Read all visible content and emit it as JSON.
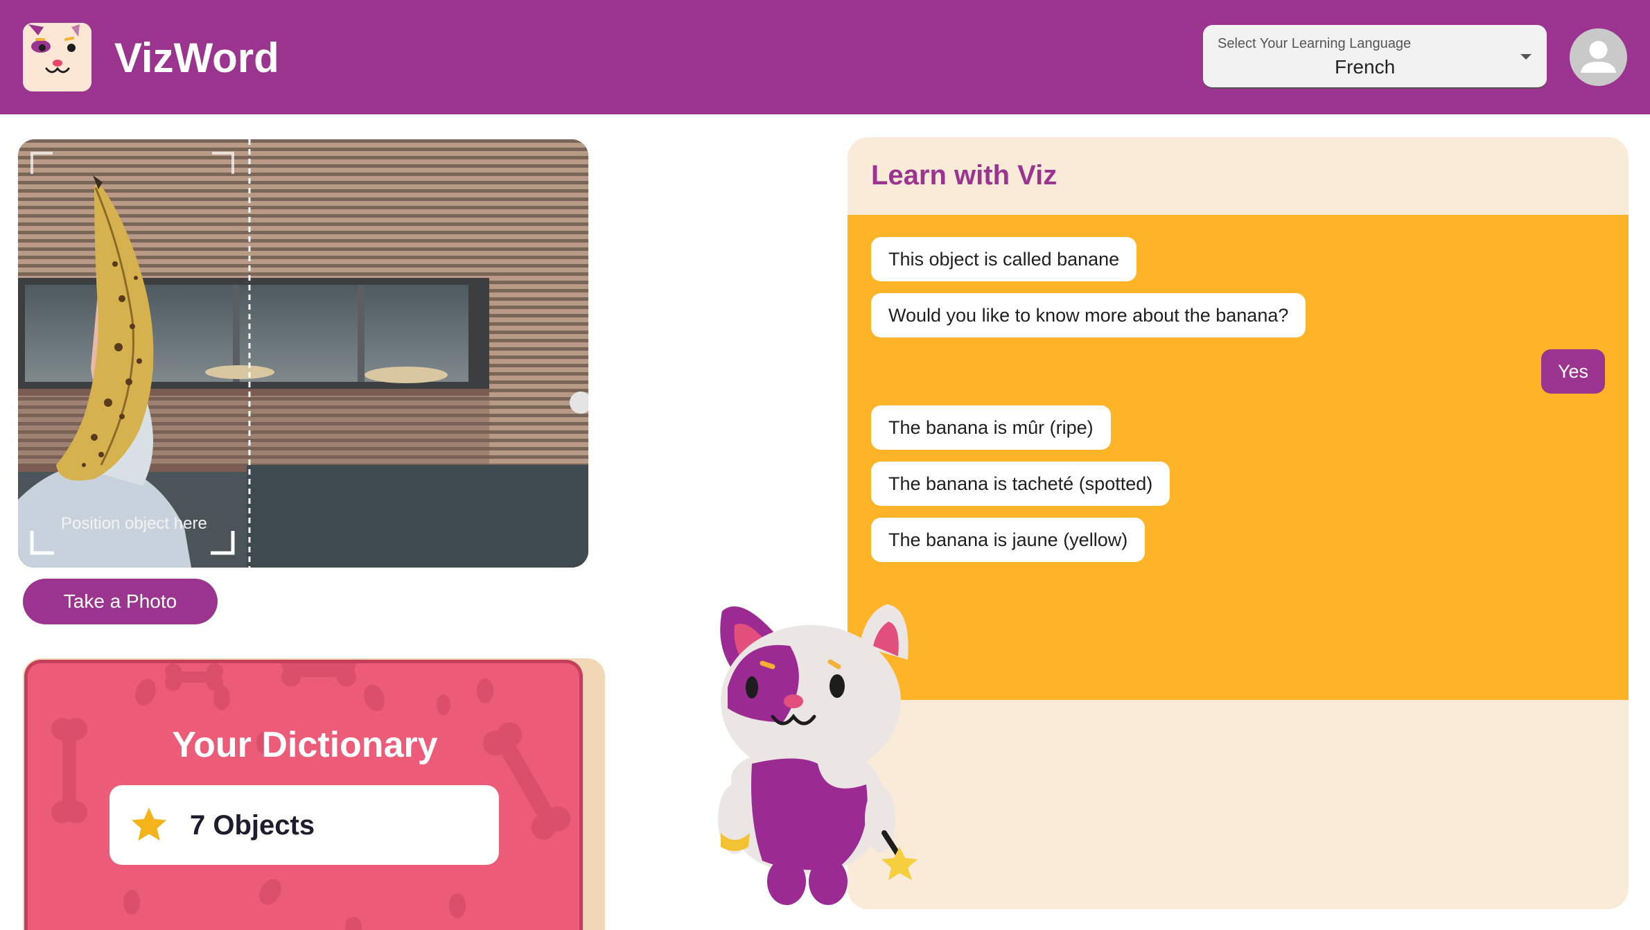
{
  "header": {
    "app_title": "VizWord",
    "language_select": {
      "label": "Select Your Learning Language",
      "value": "French"
    }
  },
  "camera": {
    "caption": "Position object here",
    "take_photo_label": "Take a Photo"
  },
  "dictionary": {
    "title": "Your Dictionary",
    "count_label": "7 Objects"
  },
  "chat": {
    "title": "Learn with Viz",
    "messages": [
      {
        "from": "viz",
        "text": "This object is called banane"
      },
      {
        "from": "viz",
        "text": "Would you like to know more about the banana?"
      },
      {
        "from": "user",
        "text": "Yes"
      },
      {
        "from": "viz",
        "text": "The banana is mûr (ripe)"
      },
      {
        "from": "viz",
        "text": "The banana is tacheté (spotted)"
      },
      {
        "from": "viz",
        "text": "The banana is jaune (yellow)"
      }
    ]
  },
  "colors": {
    "brand_purple": "#9b348e",
    "chat_orange": "#ffb326",
    "dictionary_pink": "#ec5b78",
    "panel_cream": "#faebd9"
  }
}
